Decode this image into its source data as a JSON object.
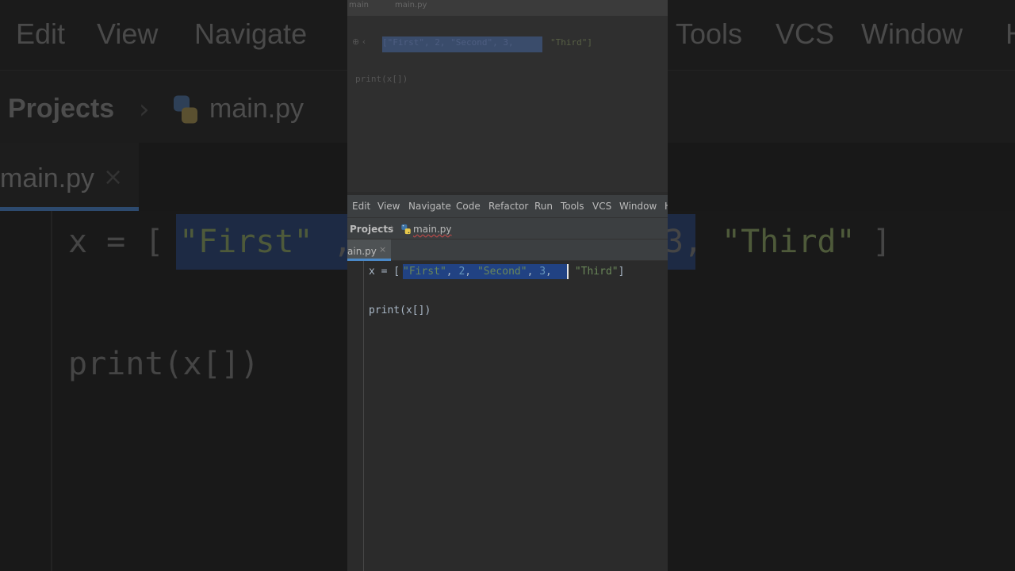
{
  "menu": {
    "items": [
      "Edit",
      "View",
      "Navigate",
      "Code",
      "Refactor",
      "Run",
      "Tools",
      "VCS",
      "Window",
      "H"
    ]
  },
  "background_menu": {
    "items": [
      "Edit",
      "View",
      "Navigate",
      "Tools",
      "VCS",
      "Window",
      "H"
    ]
  },
  "breadcrumb": {
    "project": "Projects",
    "file": "main.py"
  },
  "tab": {
    "label": "ain.py",
    "close": "×"
  },
  "background_tab": {
    "label": "main.py",
    "close": "×"
  },
  "previous_frame": {
    "top_label": "main",
    "file_label": "main.py",
    "code_selected": "[\"First\", 2, \"Second\", 3,",
    "code_rest": "\"Third\"]",
    "print_line": "print(x[])"
  },
  "code": {
    "line1_prefix": "x = [",
    "line1_selected_tokens": [
      "\"First\"",
      ", ",
      "2",
      ", ",
      "\"Second\"",
      ", ",
      "3",
      ","
    ],
    "line1_suffix_tokens": [
      " ",
      "\"Third\"",
      "]"
    ],
    "line2": "print(x[])"
  },
  "background_code": {
    "line1_prefix": "x = [",
    "line1_str1": "\"First\"",
    "line1_mid": ",",
    "line1_rest_num": "3,",
    "line1_str3": "\"Third\"",
    "line1_end": "]",
    "line2": "print(x[])"
  },
  "colors": {
    "string": "#6a8759",
    "number": "#6897bb",
    "selection": "#214283",
    "tab_underline": "#4a88c7"
  },
  "icons": [
    "python-file-icon",
    "close-icon",
    "chevron-right-icon"
  ]
}
